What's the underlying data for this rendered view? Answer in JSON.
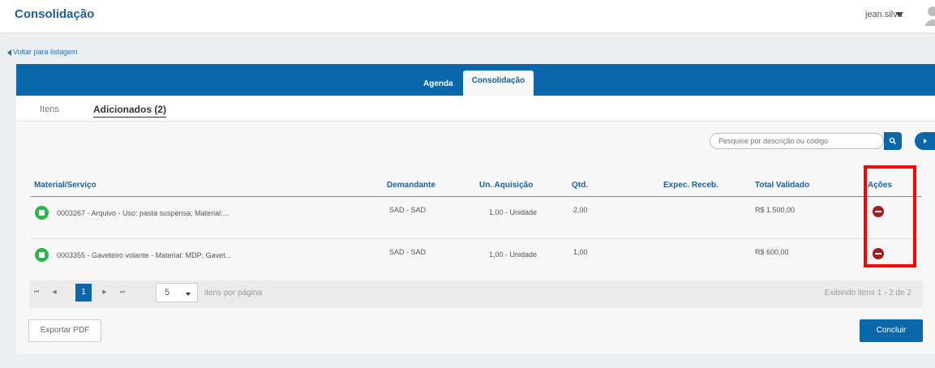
{
  "header": {
    "title": "Consolidação",
    "user": "jean.silva"
  },
  "back_link": "Voltar para listagem",
  "tabs": [
    {
      "label": "Agenda"
    },
    {
      "label": "Consolidação",
      "active": true
    }
  ],
  "subtabs": [
    {
      "label": "Itens"
    },
    {
      "label": "Adicionados (2)",
      "active": true
    }
  ],
  "search": {
    "placeholder": "Pesquise por descrição ou código"
  },
  "table": {
    "columns": [
      "Material/Serviço",
      "Demandante",
      "Un. Aquisição",
      "Qtd.",
      "Expec. Receb.",
      "Total Validado",
      "Ações"
    ],
    "rows": [
      {
        "description": "0003267 - Arquivo - Uso: pasta suspensa; Material:...",
        "demandante": "SAD - SAD",
        "unidade": "1,00 - Unidade",
        "qtd": "2,00",
        "expec": "",
        "total": "R$ 1.500,00"
      },
      {
        "description": "0003355 - Gaveteiro volante - Material: MDP; Gavet...",
        "demandante": "SAD - SAD",
        "unidade": "1,00 - Unidade",
        "qtd": "1,00",
        "expec": "",
        "total": "R$ 600,00"
      }
    ]
  },
  "pagination": {
    "first": "⏮",
    "prev": "◀",
    "current": "1",
    "next": "▶",
    "last": "⏭",
    "page_size": "5",
    "per_page_label": "itens por página",
    "showing": "Exibindo itens 1 - 2 de 2"
  },
  "buttons": {
    "export": "Exportar PDF",
    "finish": "Concluir"
  },
  "colors": {
    "brand": "#0a67a9",
    "remove": "#a31d1d",
    "status": "#2fb34a",
    "highlight": "#ff0000"
  }
}
